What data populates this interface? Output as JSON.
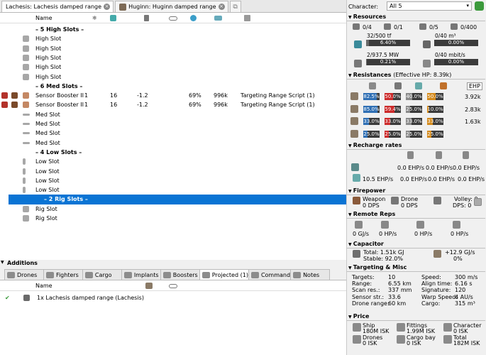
{
  "tabs": [
    {
      "label": "Lachesis: Lachesis damped range",
      "active": true
    },
    {
      "label": "Huginn: Huginn damped range",
      "active": false
    }
  ],
  "grid": {
    "headers": [
      "Name"
    ],
    "rows": [
      {
        "kind": "header",
        "name": "– 5 High Slots –"
      },
      {
        "kind": "slot",
        "icon": "high-slot-icon",
        "name": "High Slot"
      },
      {
        "kind": "slot",
        "icon": "high-slot-icon",
        "name": "High Slot"
      },
      {
        "kind": "slot",
        "icon": "high-slot-icon",
        "name": "High Slot"
      },
      {
        "kind": "slot",
        "icon": "high-slot-icon",
        "name": "High Slot"
      },
      {
        "kind": "slot",
        "icon": "high-slot-icon",
        "name": "High Slot"
      },
      {
        "kind": "header",
        "name": "– 6 Med Slots –"
      },
      {
        "kind": "module",
        "icon": "sensor-booster-icon",
        "name": "Sensor Booster II",
        "qty": "1",
        "cpu": "16",
        "pg": "-1.2",
        "pct": "69%",
        "range": "996k",
        "charge": "Targeting Range Script (1)"
      },
      {
        "kind": "module",
        "icon": "sensor-booster-icon",
        "name": "Sensor Booster II",
        "qty": "1",
        "cpu": "16",
        "pg": "-1.2",
        "pct": "69%",
        "range": "996k",
        "charge": "Targeting Range Script (1)"
      },
      {
        "kind": "slot",
        "icon": "med-slot-icon",
        "name": "Med Slot"
      },
      {
        "kind": "slot",
        "icon": "med-slot-icon",
        "name": "Med Slot"
      },
      {
        "kind": "slot",
        "icon": "med-slot-icon",
        "name": "Med Slot"
      },
      {
        "kind": "slot",
        "icon": "med-slot-icon",
        "name": "Med Slot"
      },
      {
        "kind": "header",
        "name": "– 4 Low Slots –"
      },
      {
        "kind": "slot",
        "icon": "low-slot-icon",
        "name": "Low Slot"
      },
      {
        "kind": "slot",
        "icon": "low-slot-icon",
        "name": "Low Slot"
      },
      {
        "kind": "slot",
        "icon": "low-slot-icon",
        "name": "Low Slot"
      },
      {
        "kind": "slot",
        "icon": "low-slot-icon",
        "name": "Low Slot"
      },
      {
        "kind": "header",
        "name": "– 2 Rig Slots –",
        "selected": true
      },
      {
        "kind": "slot",
        "icon": "rig-slot-icon",
        "name": "Rig Slot"
      },
      {
        "kind": "slot",
        "icon": "rig-slot-icon",
        "name": "Rig Slot"
      }
    ]
  },
  "additions": {
    "title": "Additions",
    "tabs": [
      "Drones",
      "Fighters",
      "Cargo",
      "Implants",
      "Boosters",
      "Projected (1)",
      "Command",
      "Notes"
    ],
    "active_tab": "Projected (1)",
    "header": "Name",
    "items": [
      {
        "check": "✔",
        "label": "1x Lachesis damped range (Lachesis)"
      }
    ]
  },
  "character": {
    "label": "Character:",
    "selected": "All 5"
  },
  "resources": {
    "title": "Resources",
    "top": [
      {
        "v": "0/4"
      },
      {
        "v": "0/1"
      },
      {
        "v": "0/5"
      },
      {
        "v": "0/400"
      }
    ],
    "cpu": {
      "text": "32/500 tf",
      "pct": "6.40%",
      "fill": 6.4
    },
    "drone_bay": {
      "text": "0/40 m³",
      "pct": "0.00%",
      "fill": 0
    },
    "pg": {
      "text": "2/937.5 MW",
      "pct": "0.21%",
      "fill": 0.21
    },
    "bandwidth": {
      "text": "0/40 mbit/s",
      "pct": "0.00%",
      "fill": 0
    }
  },
  "resistances": {
    "title": "Resistances",
    "effective": "(Effective HP: 8.39k)",
    "ehp_label": "EHP",
    "rows": [
      {
        "v": [
          "82.5%",
          "50.0%",
          "40.0%",
          "50.0%"
        ],
        "f": [
          82.5,
          50,
          40,
          50
        ],
        "ehp": "3.92k"
      },
      {
        "v": [
          "85.0%",
          "59.4%",
          "25.0%",
          "10.0%"
        ],
        "f": [
          85,
          59.4,
          25,
          10
        ],
        "ehp": "2.83k"
      },
      {
        "v": [
          "33.0%",
          "33.0%",
          "33.0%",
          "33.0%"
        ],
        "f": [
          33,
          33,
          33,
          33
        ],
        "ehp": "1.63k"
      },
      {
        "v": [
          "25.0%",
          "25.0%",
          "25.0%",
          "25.0%"
        ],
        "f": [
          25,
          25,
          25,
          25
        ],
        "ehp": ""
      }
    ],
    "colors": [
      "#2f6fb4",
      "#cc2a2a",
      "#8a8a8a",
      "#d48a1c"
    ]
  },
  "recharge": {
    "title": "Recharge rates",
    "row1": [
      "0.0 EHP/s",
      "0.0 EHP/s",
      "0.0 EHP/s"
    ],
    "row2": [
      "10.5 EHP/s",
      "0.0 EHP/s",
      "0.0 EHP/s",
      "0.0 EHP/s"
    ]
  },
  "firepower": {
    "title": "Firepower",
    "weapon": "Weapon",
    "weapon_dps": "0 DPS",
    "drone": "Drone",
    "drone_dps": "0 DPS",
    "volley": "Volley: 0",
    "dps": "DPS: 0"
  },
  "remote_reps": {
    "title": "Remote Reps",
    "vals": [
      "0 GJ/s",
      "0 HP/s",
      "0 HP/s",
      "0 HP/s"
    ]
  },
  "capacitor": {
    "title": "Capacitor",
    "total": "Total: 1.51k GJ",
    "stable": "Stable: 92.0%",
    "rate": "+12.9 GJ/s",
    "delta": "0%"
  },
  "targeting": {
    "title": "Targeting & Misc",
    "left": [
      [
        "Targets:",
        "10"
      ],
      [
        "Range:",
        "6.55 km"
      ],
      [
        "Scan res.:",
        "337 mm"
      ],
      [
        "Sensor str.:",
        "33.6"
      ],
      [
        "Drone range:",
        "60 km"
      ]
    ],
    "right": [
      [
        "Speed:",
        "300 m/s"
      ],
      [
        "Align time:",
        "6.16 s"
      ],
      [
        "Signature:",
        "120"
      ],
      [
        "Warp Speed:",
        "4 AU/s"
      ],
      [
        "Cargo:",
        "315 m³"
      ]
    ]
  },
  "price": {
    "title": "Price",
    "items": [
      [
        "Ship",
        "180M ISK"
      ],
      [
        "Fittings",
        "1.99M ISK"
      ],
      [
        "Character",
        "0 ISK"
      ],
      [
        "Drones",
        "0 ISK"
      ],
      [
        "Cargo bay",
        "0 ISK"
      ],
      [
        "Total",
        "182M ISK"
      ]
    ]
  }
}
